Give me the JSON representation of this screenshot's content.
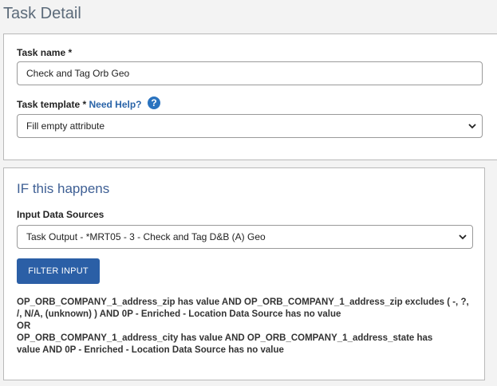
{
  "page": {
    "title": "Task Detail"
  },
  "task": {
    "name_label": "Task name *",
    "name_value": "Check and Tag Orb Geo",
    "template_label": "Task template *",
    "help_link": "Need Help?",
    "help_icon": "?",
    "template_value": "Fill empty attribute"
  },
  "condition": {
    "title": "IF this happens",
    "sources_label": "Input Data Sources",
    "sources_value": "Task Output - *MRT05 - 3 - Check and Tag D&B (A) Geo",
    "filter_button": "FILTER INPUT",
    "lines": [
      "OP_ORB_COMPANY_1_address_zip has value AND OP_ORB_COMPANY_1_address_zip excludes ( -, ?,",
      "/, N/A, (unknown) ) AND 0P - Enriched - Location Data Source has no value",
      "OR",
      "OP_ORB_COMPANY_1_address_city has value AND OP_ORB_COMPANY_1_address_state has",
      "value AND 0P - Enriched - Location Data Source has no value"
    ]
  },
  "icons": {
    "dropdown": "chevron-down-icon",
    "help": "question-circle-icon"
  },
  "colors": {
    "accent": "#2b5fa6",
    "title": "#5c6b7a",
    "section_title": "#3e5f94"
  }
}
